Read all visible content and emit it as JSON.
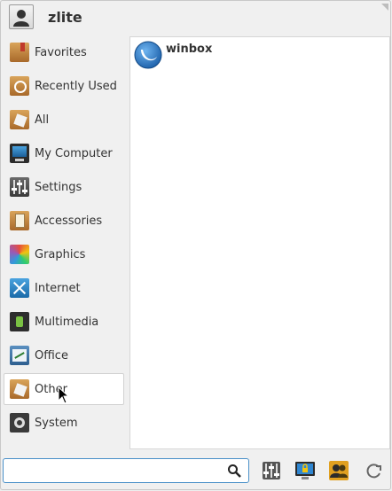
{
  "header": {
    "username": "zlite",
    "avatar_icon": "user-avatar-icon"
  },
  "categories": [
    {
      "label": "Favorites",
      "icon": "favorites-icon"
    },
    {
      "label": "Recently Used",
      "icon": "recently-used-icon"
    },
    {
      "label": "All",
      "icon": "all-icon"
    },
    {
      "label": "My Computer",
      "icon": "my-computer-icon"
    },
    {
      "label": "Settings",
      "icon": "settings-icon"
    },
    {
      "label": "Accessories",
      "icon": "accessories-icon"
    },
    {
      "label": "Graphics",
      "icon": "graphics-icon"
    },
    {
      "label": "Internet",
      "icon": "internet-icon"
    },
    {
      "label": "Multimedia",
      "icon": "multimedia-icon"
    },
    {
      "label": "Office",
      "icon": "office-icon"
    },
    {
      "label": "Other",
      "icon": "other-icon",
      "selected": true
    },
    {
      "label": "System",
      "icon": "system-icon"
    }
  ],
  "apps": [
    {
      "label": "winbox",
      "icon": "winbox-icon"
    }
  ],
  "search": {
    "value": "",
    "placeholder": ""
  },
  "footer": {
    "buttons": [
      "settings-manager-icon",
      "lock-screen-icon",
      "switch-user-icon",
      "logout-icon"
    ]
  },
  "colors": {
    "accent": "#4a90c8",
    "background": "#f0f0f0",
    "selection": "#ffffff"
  }
}
